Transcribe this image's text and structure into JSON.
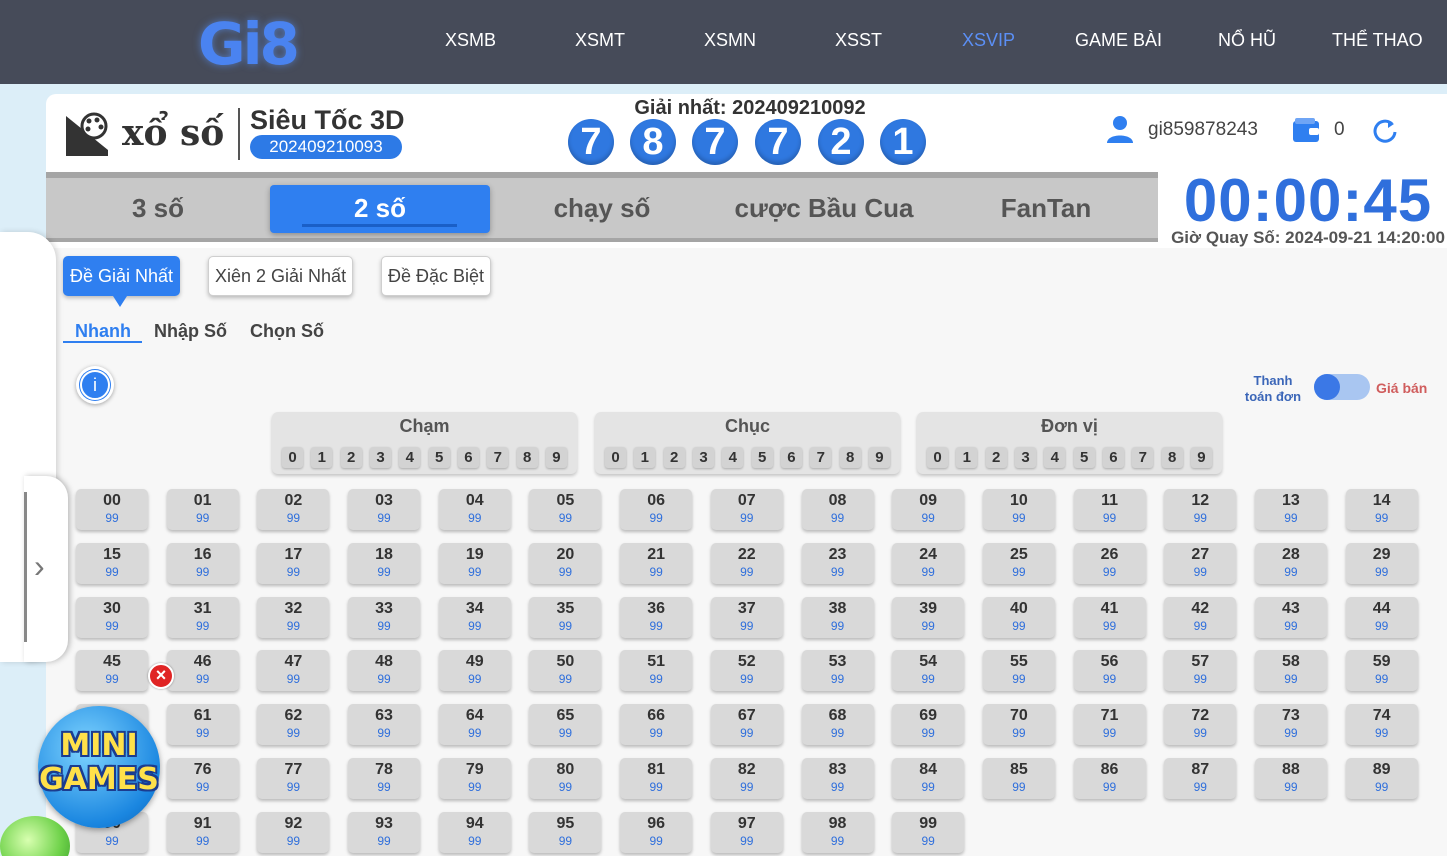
{
  "nav": {
    "logo": "Gi8",
    "items": [
      {
        "label": "XSMB",
        "active": false
      },
      {
        "label": "XSMT",
        "active": false
      },
      {
        "label": "XSMN",
        "active": false
      },
      {
        "label": "XSST",
        "active": false
      },
      {
        "label": "XSVIP",
        "active": true
      },
      {
        "label": "GAME BÀI",
        "active": false
      },
      {
        "label": "NỔ HŨ",
        "active": false
      },
      {
        "label": "THỂ THAO",
        "active": false
      }
    ]
  },
  "header": {
    "brand": "xổ số",
    "game_title": "Siêu Tốc 3D",
    "period": "202409210093",
    "prize_label": "Giải nhất: 202409210092",
    "result_digits": [
      "7",
      "8",
      "7",
      "7",
      "2",
      "1"
    ],
    "username": "gi859878243",
    "balance": "0"
  },
  "tabs": [
    {
      "label": "3 số",
      "active": false
    },
    {
      "label": "2 số",
      "active": true
    },
    {
      "label": "chạy số",
      "active": false
    },
    {
      "label": "cược Bầu Cua",
      "active": false
    },
    {
      "label": "FanTan",
      "active": false
    }
  ],
  "countdown": "00:00:45",
  "draw_time": "Giờ Quay Số: 2024-09-21 14:20:00",
  "bet_types": [
    {
      "label": "Đề Giải Nhất",
      "active": true
    },
    {
      "label": "Xiên 2 Giải Nhất",
      "active": false
    },
    {
      "label": "Đề Đặc Biệt",
      "active": false
    }
  ],
  "modes": [
    {
      "label": "Nhanh",
      "active": true
    },
    {
      "label": "Nhập Số",
      "active": false
    },
    {
      "label": "Chọn Số",
      "active": false
    }
  ],
  "toggle": {
    "left_label": "Thanh toán đơn",
    "right_label": "Giá bán"
  },
  "digit_groups": [
    {
      "title": "Chạm",
      "digits": [
        "0",
        "1",
        "2",
        "3",
        "4",
        "5",
        "6",
        "7",
        "8",
        "9"
      ]
    },
    {
      "title": "Chục",
      "digits": [
        "0",
        "1",
        "2",
        "3",
        "4",
        "5",
        "6",
        "7",
        "8",
        "9"
      ]
    },
    {
      "title": "Đơn vị",
      "digits": [
        "0",
        "1",
        "2",
        "3",
        "4",
        "5",
        "6",
        "7",
        "8",
        "9"
      ]
    }
  ],
  "number_odds": "99",
  "mini_games": {
    "line1": "MINI",
    "line2": "GAMES"
  },
  "colors": {
    "accent": "#2f7ff0",
    "nav_bg": "#464b59",
    "odds": "#2f6fdc",
    "close": "#e02424"
  }
}
